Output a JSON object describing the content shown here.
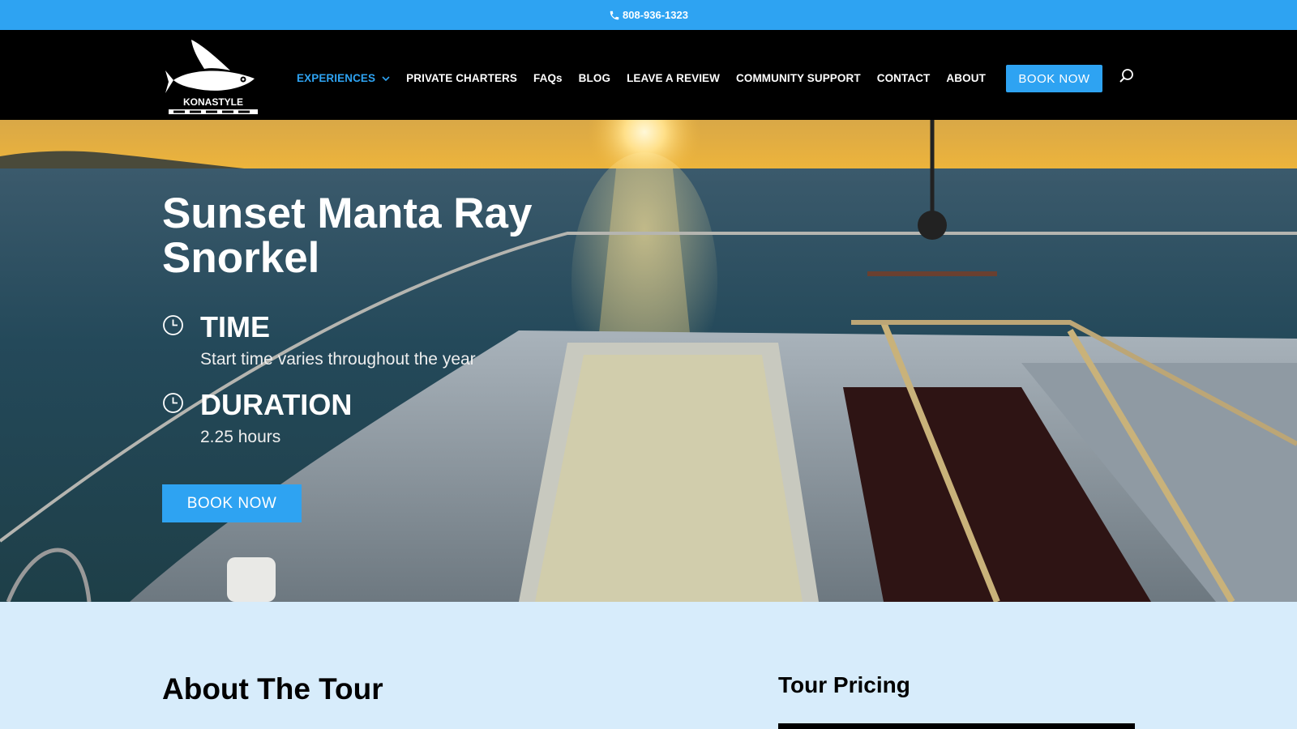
{
  "topbar": {
    "phone": "808-936-1323"
  },
  "header": {
    "nav": [
      {
        "label": "EXPERIENCES",
        "active": true,
        "dropdown": true
      },
      {
        "label": "PRIVATE CHARTERS"
      },
      {
        "label": "FAQs"
      },
      {
        "label": "BLOG"
      },
      {
        "label": "LEAVE A REVIEW"
      },
      {
        "label": "COMMUNITY SUPPORT"
      },
      {
        "label": "CONTACT"
      },
      {
        "label": "ABOUT"
      }
    ],
    "book_label": "BOOK NOW"
  },
  "hero": {
    "title": "Sunset Manta Ray Snorkel",
    "time_label": "TIME",
    "time_value": "Start time varies throughout the year",
    "duration_label": "DURATION",
    "duration_value": "2.25 hours",
    "book_label": "BOOK NOW"
  },
  "main": {
    "about_title": "About The Tour",
    "pricing_title": "Tour Pricing"
  },
  "colors": {
    "accent": "#2ea3f2",
    "header_bg": "#000000",
    "page_bg": "#d7ecfb"
  }
}
